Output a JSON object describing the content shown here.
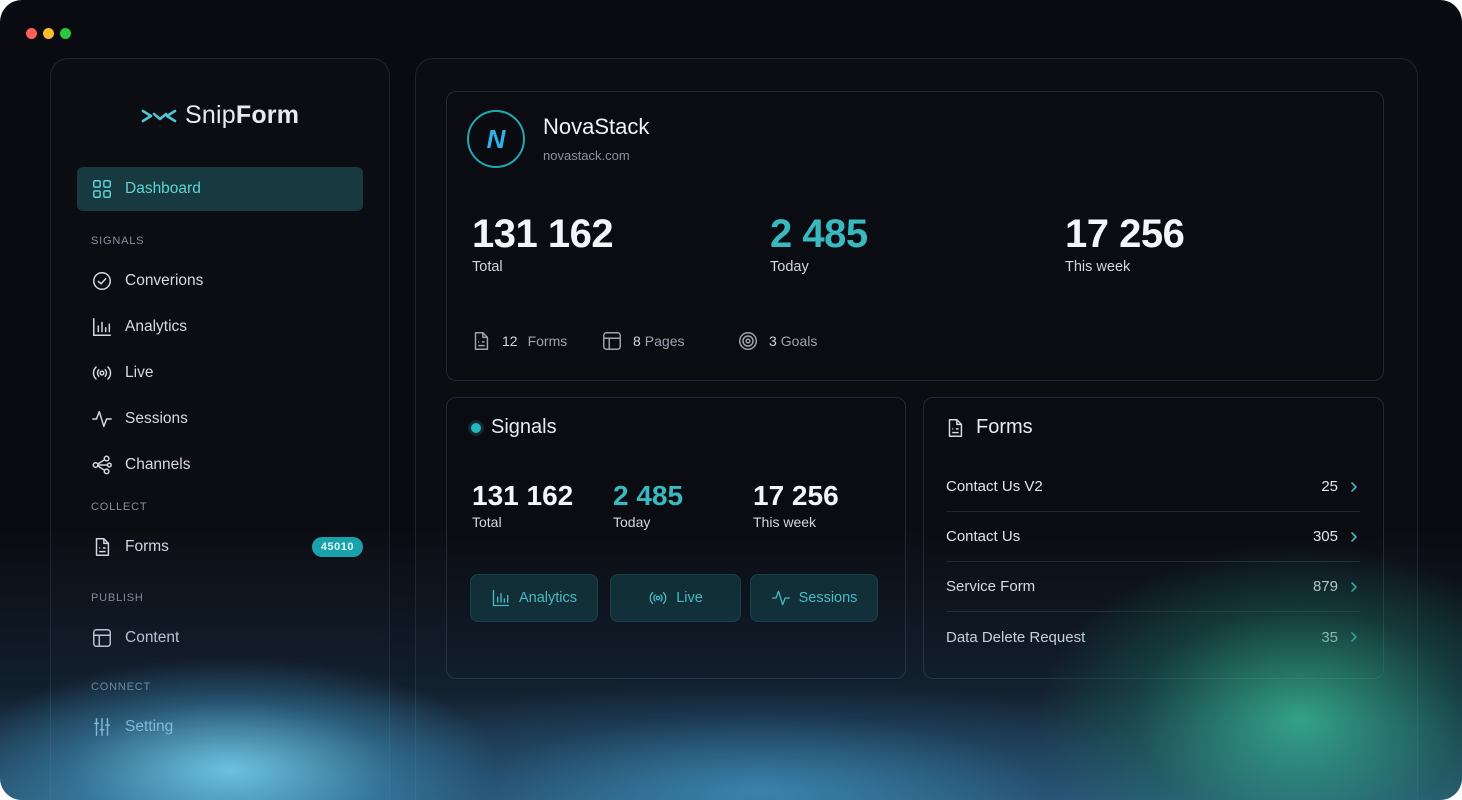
{
  "window": {
    "controls": [
      "close",
      "minimize",
      "maximize"
    ],
    "control_colors": [
      "#ff5f57",
      "#febc2e",
      "#28c840"
    ]
  },
  "sidebar": {
    "logo": {
      "prefix": "Snip",
      "suffix": "Form",
      "icon": "snipform-logo-icon"
    },
    "dashboard": {
      "label": "Dashboard",
      "icon": "grid-icon"
    },
    "sections": {
      "signals": "SIGNALS",
      "collect": "COLLECT",
      "publish": "PUBLISH",
      "connect": "CONNECT"
    },
    "signals_items": [
      {
        "label": "Converions",
        "icon": "check-circle-icon"
      },
      {
        "label": "Analytics",
        "icon": "bar-chart-icon"
      },
      {
        "label": "Live",
        "icon": "broadcast-icon"
      },
      {
        "label": "Sessions",
        "icon": "pulse-icon"
      },
      {
        "label": "Channels",
        "icon": "share-nodes-icon"
      }
    ],
    "forms": {
      "label": "Forms",
      "icon": "document-icon",
      "badge": "45010"
    },
    "content": {
      "label": "Content",
      "icon": "layout-icon"
    },
    "setting": {
      "label": "Setting",
      "icon": "sliders-icon"
    }
  },
  "brand": {
    "name": "NovaStack",
    "url": "novastack.com",
    "avatar_letter": "N",
    "stats": [
      {
        "value": "131 162",
        "label": "Total"
      },
      {
        "value": "2 485",
        "label": "Today"
      },
      {
        "value": "17 256",
        "label": "This week"
      }
    ],
    "meta": [
      {
        "value": "12",
        "label": "Forms",
        "icon": "document-icon"
      },
      {
        "value": "8",
        "label": "Pages",
        "icon": "layout-icon"
      },
      {
        "value": "3",
        "label": "Goals",
        "icon": "target-icon"
      }
    ]
  },
  "signals": {
    "title": "Signals",
    "stats": [
      {
        "value": "131 162",
        "label": "Total"
      },
      {
        "value": "2 485",
        "label": "Today"
      },
      {
        "value": "17 256",
        "label": "This week"
      }
    ],
    "buttons": [
      {
        "label": "Analytics",
        "icon": "bar-chart-icon"
      },
      {
        "label": "Live",
        "icon": "broadcast-icon"
      },
      {
        "label": "Sessions",
        "icon": "pulse-icon"
      }
    ]
  },
  "forms": {
    "title": "Forms",
    "rows": [
      {
        "name": "Contact Us V2",
        "count": "25"
      },
      {
        "name": "Contact Us",
        "count": "305"
      },
      {
        "name": "Service Form",
        "count": "879"
      },
      {
        "name": "Data Delete Request",
        "count": "35"
      }
    ]
  },
  "colors": {
    "accent": "#39b8c0",
    "active_bg": "#173a40",
    "badge": "#1aa3ad"
  }
}
